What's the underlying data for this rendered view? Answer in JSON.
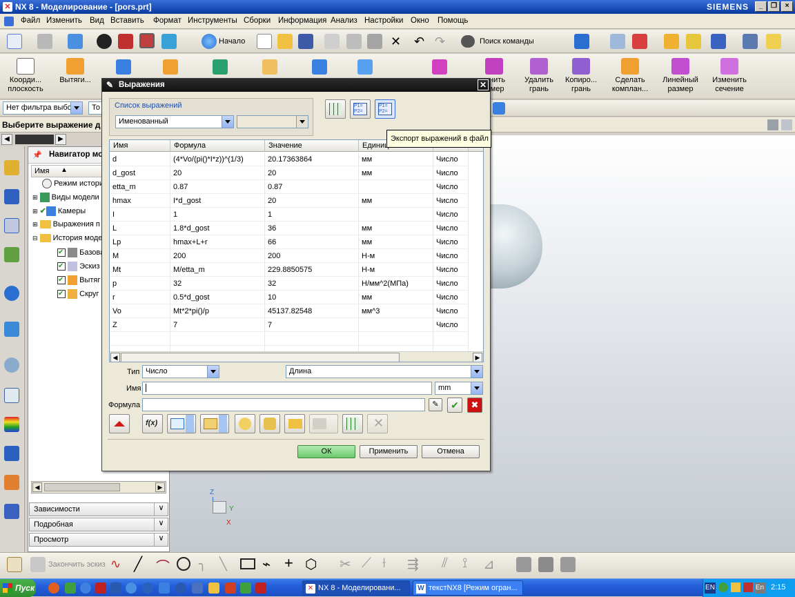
{
  "window": {
    "title": "NX 8 - Моделирование - [pors.prt]",
    "brand": "SIEMENS",
    "controls": [
      "_",
      "❐",
      "×"
    ]
  },
  "menu": [
    "Файл",
    "Изменить",
    "Вид",
    "Вставить",
    "Формат",
    "Инструменты",
    "Сборки",
    "Информация",
    "Анализ",
    "Настройки",
    "Окно",
    "Помощь"
  ],
  "toolbar1": {
    "start_label": "Начало",
    "search_label": "Поиск команды"
  },
  "toolbar2": {
    "left_buttons": [
      "Коорди...\nплоскость",
      "Вытяги..."
    ],
    "right_buttons": [
      "...нить\n...мер",
      "Удалить\nгрань",
      "Копиро...\nгрань",
      "Сделать\nкомплан...",
      "Линейный\nразмер",
      "Изменить\nсечение"
    ]
  },
  "filterbar": {
    "filter": "Нет фильтра выбо",
    "second": "То"
  },
  "prompt": "Выберите выражение д",
  "navigator": {
    "title": "Навигатор мо",
    "col_name": "Имя",
    "items": [
      "Режим истори",
      "Виды модели",
      "Камеры",
      "Выражения п",
      "История моде",
      "Базова",
      "Эскиз",
      "Вытяг",
      "Скруг"
    ],
    "panels": [
      "Зависимости",
      "Подробная",
      "Просмотр"
    ]
  },
  "dialog": {
    "title": "Выражения",
    "list_label": "Список выражений",
    "list_value": "Именованный",
    "tooltip": "Экспорт выражений в файл",
    "columns": [
      "Имя",
      "Формула",
      "Значение",
      "Единиц",
      ""
    ],
    "rows": [
      [
        "d",
        "(4*Vo/(pi()*I*z))^(1/3)",
        "20.17363864",
        "мм",
        "Число"
      ],
      [
        "d_gost",
        "20",
        "20",
        "мм",
        "Число"
      ],
      [
        "etta_m",
        "0.87",
        "0.87",
        "",
        "Число"
      ],
      [
        "hmax",
        "I*d_gost",
        "20",
        "мм",
        "Число"
      ],
      [
        "I",
        "1",
        "1",
        "",
        "Число"
      ],
      [
        "L",
        "1.8*d_gost",
        "36",
        "мм",
        "Число"
      ],
      [
        "Lp",
        "hmax+L+r",
        "66",
        "мм",
        "Число"
      ],
      [
        "M",
        "200",
        "200",
        "Н-м",
        "Число"
      ],
      [
        "Mt",
        "M/etta_m",
        "229.8850575",
        "Н-м",
        "Число"
      ],
      [
        "p",
        "32",
        "32",
        "Н/мм^2(МПа)",
        "Число"
      ],
      [
        "r",
        "0.5*d_gost",
        "10",
        "мм",
        "Число"
      ],
      [
        "Vo",
        "Mt*2*pi()/p",
        "45137.82548",
        "мм^3",
        "Число"
      ],
      [
        "Z",
        "7",
        "7",
        "",
        "Число"
      ]
    ],
    "type_label": "Тип",
    "type_value": "Число",
    "dimension_value": "Длина",
    "name_label": "Имя",
    "name_value": "",
    "unit_value": "mm",
    "formula_label": "Формула",
    "formula_value": "",
    "ok": "ОК",
    "apply": "Применить",
    "cancel": "Отмена"
  },
  "sketchbar": {
    "finish_label": "Закончить эскиз"
  },
  "taskbar": {
    "start": "Пуск",
    "items": [
      "NX 8 - Моделировани...",
      "текстNX8 [Режим огран..."
    ],
    "lang": "EN",
    "lang2": "En",
    "clock": "2:15"
  },
  "axes": {
    "z": "Z",
    "y": "Y",
    "x": "X"
  },
  "colors": {
    "title_bar": "#1a4fb8",
    "ok_button": "#8fd48f",
    "confirm_green": "#2a9a2a",
    "cancel_red": "#cc1111"
  }
}
